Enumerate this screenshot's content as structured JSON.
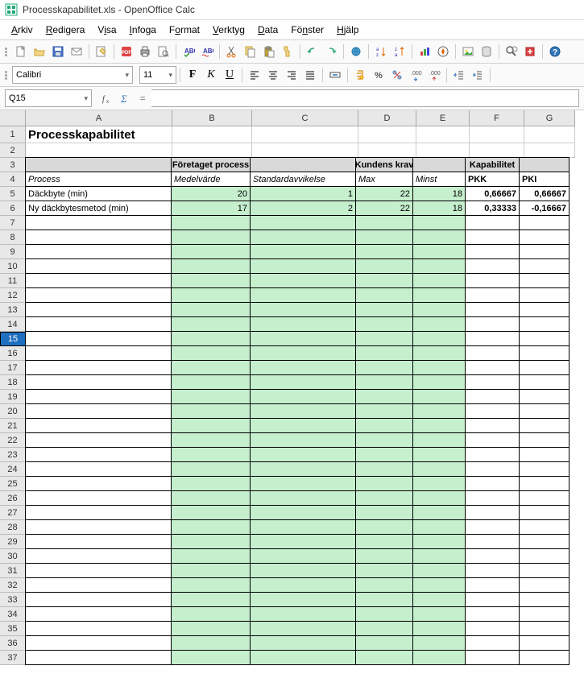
{
  "window": {
    "title": "Processkapabilitet.xls - OpenOffice Calc"
  },
  "menu": [
    "Arkiv",
    "Redigera",
    "Visa",
    "Infoga",
    "Format",
    "Verktyg",
    "Data",
    "Fönster",
    "Hjälp"
  ],
  "format_bar": {
    "font": "Calibri",
    "size": "11",
    "bold": "F",
    "italic": "K",
    "underline": "U"
  },
  "name_box": "Q15",
  "columns": [
    "A",
    "B",
    "C",
    "D",
    "E",
    "F",
    "G"
  ],
  "sheet": {
    "title": "Processkapabilitet",
    "section_headers": {
      "foretaget": "Företaget process",
      "kundens": "Kundens krav",
      "kapabilitet": "Kapabilitet"
    },
    "col_headers": {
      "process": "Process",
      "medelvarde": "Medelvärde",
      "standardavvikelse": "Standardavvikelse",
      "max": "Max",
      "minst": "Minst",
      "pkk": "PKK",
      "pki": "PKI"
    },
    "rows": [
      {
        "process": "Däckbyte (min)",
        "medel": "20",
        "std": "1",
        "max": "22",
        "minst": "18",
        "pkk": "0,66667",
        "pki": "0,66667"
      },
      {
        "process": "Ny däckbytesmetod (min)",
        "medel": "17",
        "std": "2",
        "max": "22",
        "minst": "18",
        "pkk": "0,33333",
        "pki": "-0,16667"
      }
    ]
  },
  "selected_row": 15,
  "visible_rows": 37
}
